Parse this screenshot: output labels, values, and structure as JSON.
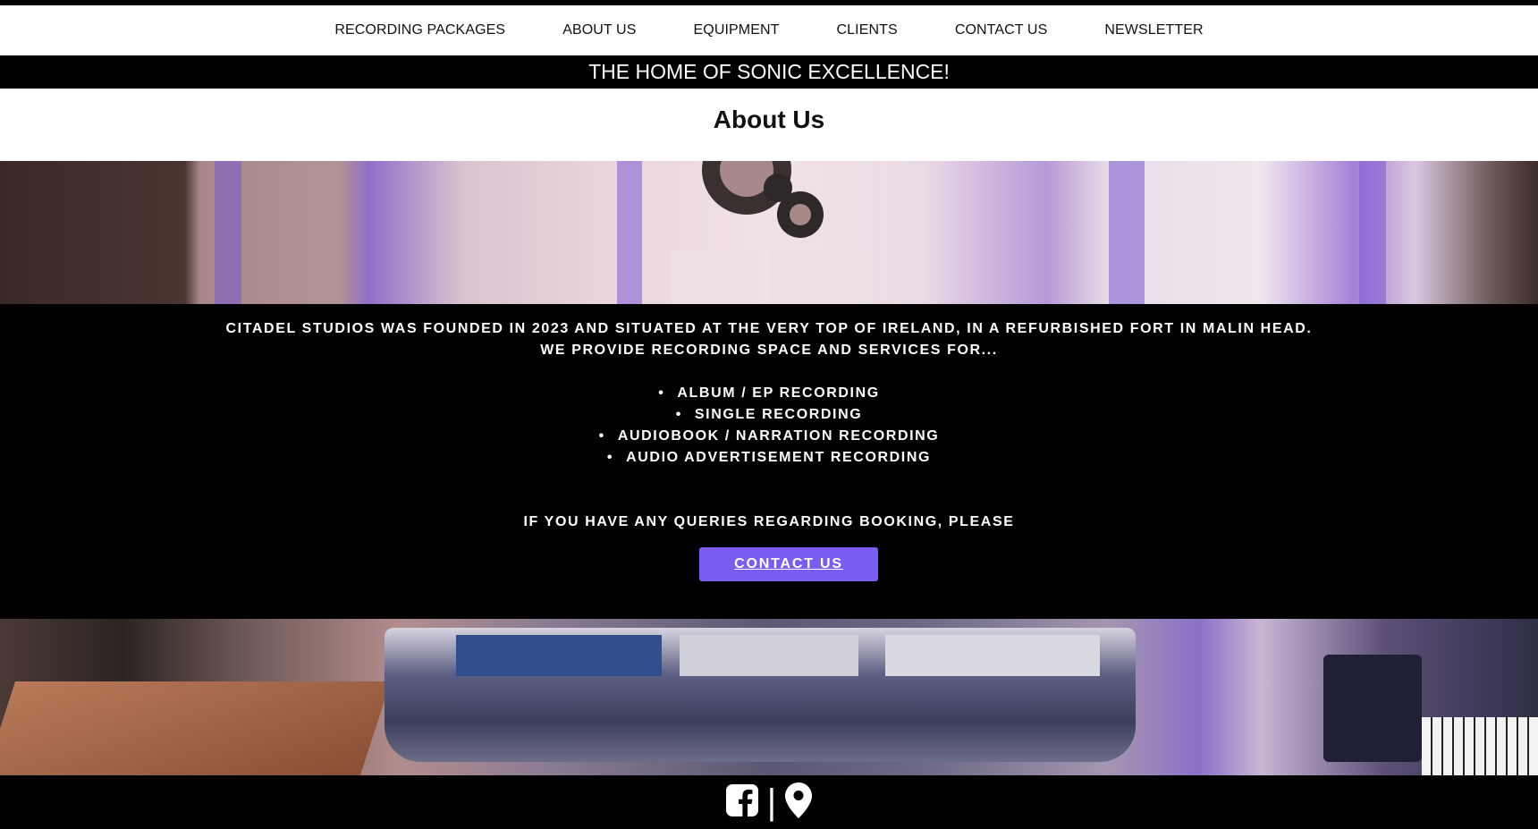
{
  "nav": {
    "items": [
      {
        "label": "RECORDING PACKAGES"
      },
      {
        "label": "ABOUT US"
      },
      {
        "label": "EQUIPMENT"
      },
      {
        "label": "CLIENTS"
      },
      {
        "label": "CONTACT US"
      },
      {
        "label": "NEWSLETTER"
      }
    ]
  },
  "tagline": "THE HOME OF SONIC EXCELLENCE!",
  "page_title": "About Us",
  "content": {
    "intro_line1": "CITADEL STUDIOS WAS FOUNDED IN 2023 AND SITUATED AT THE VERY TOP OF IRELAND, IN A REFURBISHED FORT IN MALIN HEAD.",
    "intro_line2": "WE PROVIDE RECORDING SPACE AND SERVICES FOR...",
    "services": [
      "ALBUM / EP RECORDING",
      "SINGLE RECORDING",
      "AUDIOBOOK / NARRATION RECORDING",
      "AUDIO ADVERTISEMENT RECORDING"
    ],
    "query": "IF YOU HAVE ANY QUERIES REGARDING BOOKING, PLEASE",
    "cta_label": "CONTACT US"
  },
  "footer": {
    "separator": "|",
    "icons": [
      "facebook-icon",
      "map-pin-icon"
    ]
  },
  "colors": {
    "accent": "#7b5cf0",
    "background": "#000000",
    "nav_background": "#ffffff"
  }
}
